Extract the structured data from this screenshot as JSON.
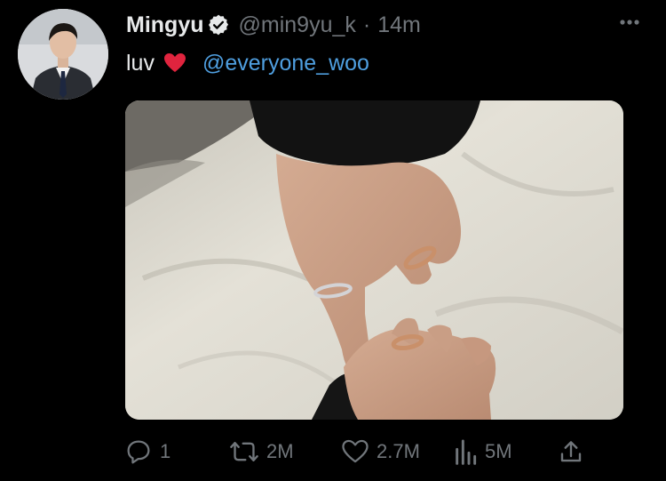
{
  "author": {
    "display_name": "Mingyu",
    "handle": "@min9yu_k",
    "separator": "·",
    "timestamp": "14m",
    "verified": true
  },
  "tweet": {
    "text": "luv",
    "emoji": "red-heart",
    "mention": "@everyone_woo"
  },
  "actions": {
    "reply_count": "1",
    "retweet_count": "2M",
    "like_count": "2.7M",
    "views_count": "5M"
  },
  "colors": {
    "background": "#000000",
    "primary_text": "#e7e9ea",
    "secondary_text": "#71767b",
    "link": "#4f9fe0",
    "heart": "#e0243e"
  },
  "icons": {
    "verified": "verified-badge-icon",
    "more": "more-dots-icon",
    "reply": "reply-icon",
    "retweet": "retweet-icon",
    "like": "heart-outline-icon",
    "views": "views-bar-chart-icon",
    "share": "share-upload-icon"
  }
}
